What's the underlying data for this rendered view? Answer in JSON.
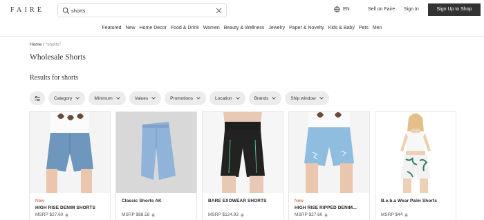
{
  "header": {
    "logo": "FAIRE",
    "search_value": "shorts",
    "language": "EN",
    "sell_label": "Sell on Faire",
    "signin_label": "Sign In",
    "signup_label": "Sign Up to Shop"
  },
  "nav": {
    "items": [
      "Featured",
      "New",
      "Home Decor",
      "Food & Drink",
      "Women",
      "Beauty & Wellness",
      "Jewelry",
      "Paper & Novelty",
      "Kids & Baby",
      "Pets",
      "Men"
    ]
  },
  "breadcrumb": {
    "home": "Home",
    "separator": "/",
    "current": "\"shorts\""
  },
  "page_title": "Wholesale Shorts",
  "results_title": "Results for shorts",
  "filters": [
    "Category",
    "Minimum",
    "Values",
    "Promotions",
    "Location",
    "Brands",
    "Ship window"
  ],
  "products": [
    {
      "badge": "New",
      "name": "HIGH RISE DENIM SHORTS",
      "price": "MSRP $27.60"
    },
    {
      "badge": "",
      "name": "Classic Shorts AK",
      "price": "MSRP $88.58"
    },
    {
      "badge": "",
      "name": "BARE EXOWEAR SHORTS",
      "price": "MSRP $124.93"
    },
    {
      "badge": "New",
      "name": "HIGH RISE RIPPED DENIM...",
      "price": "MSRP $27.60"
    },
    {
      "badge": "",
      "name": "B.e.b.a Wear Palm Shorts",
      "price": "MSRP $44"
    }
  ],
  "colors": {
    "primary_dark": "#333333",
    "new_badge": "#c4512a",
    "chip_bg": "#ececec"
  }
}
